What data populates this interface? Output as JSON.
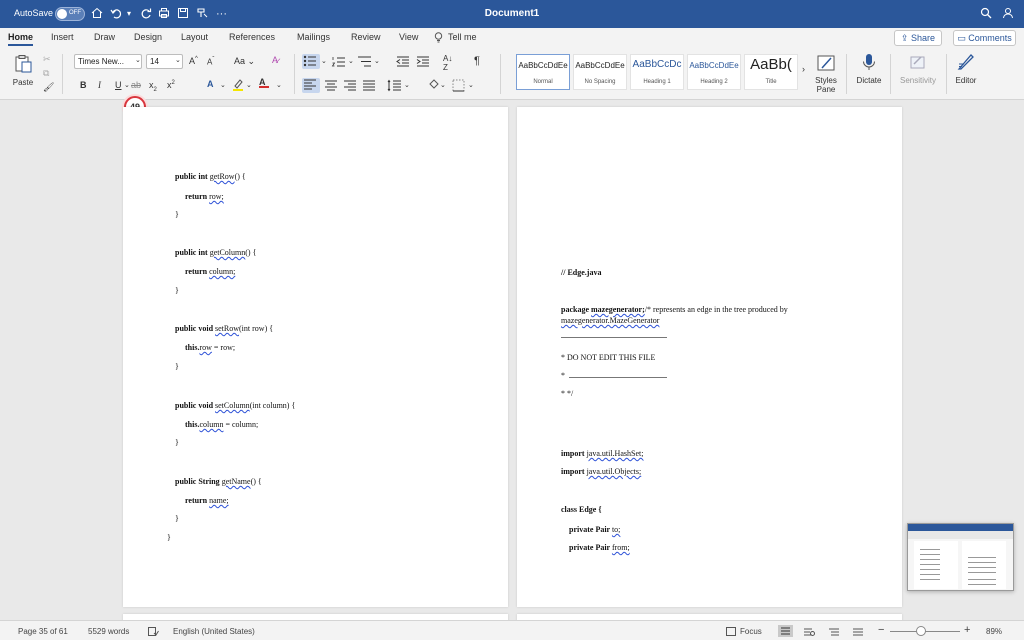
{
  "titlebar": {
    "autosave_label": "AutoSave",
    "autosave_state": "OFF",
    "document_title": "Document1"
  },
  "tabs": [
    "Home",
    "Insert",
    "Draw",
    "Design",
    "Layout",
    "References",
    "Mailings",
    "Review",
    "View"
  ],
  "tell_me": "Tell me",
  "share_label": "Share",
  "comments_label": "Comments",
  "ribbon": {
    "paste_label": "Paste",
    "font_name": "Times New...",
    "font_size": "14",
    "styles": [
      {
        "sample": "AaBbCcDdEe",
        "name": "Normal"
      },
      {
        "sample": "AaBbCcDdEe",
        "name": "No Spacing"
      },
      {
        "sample": "AaBbCcDc",
        "name": "Heading 1"
      },
      {
        "sample": "AaBbCcDdEe",
        "name": "Heading 2"
      },
      {
        "sample": "AaBb(",
        "name": "Title"
      }
    ],
    "styles_pane_label": "Styles Pane",
    "dictate_label": "Dictate",
    "sensitivity_label": "Sensitivity",
    "editor_label": "Editor"
  },
  "comment_badge_count": "49",
  "left_page": {
    "lines": [
      {
        "kw": "public int ",
        "ul": "getRow",
        "rest": "() {"
      },
      {
        "kw": "return ",
        "ul": "row;",
        "rest": ""
      },
      {
        "kw": "",
        "ul": "",
        "rest": "}"
      },
      {
        "kw": "public int ",
        "ul": "getColumn",
        "rest": "() {"
      },
      {
        "kw": "return ",
        "ul": "column;",
        "rest": ""
      },
      {
        "kw": "",
        "ul": "",
        "rest": "}"
      },
      {
        "kw": "public void ",
        "ul": "setRow",
        "rest": "(int row) {"
      },
      {
        "kw": "this.",
        "ul": "row",
        "rest": " = row;"
      },
      {
        "kw": "",
        "ul": "",
        "rest": "}"
      },
      {
        "kw": "public void ",
        "ul": "setColumn",
        "rest": "(int column) {"
      },
      {
        "kw": "this.",
        "ul": "column",
        "rest": " = column;"
      },
      {
        "kw": "",
        "ul": "",
        "rest": "}"
      },
      {
        "kw": "public String ",
        "ul": "getName",
        "rest": "() {"
      },
      {
        "kw": "return ",
        "ul": "name;",
        "rest": ""
      },
      {
        "kw": "",
        "ul": "",
        "rest": "}"
      },
      {
        "kw": "",
        "ul": "",
        "rest": "}"
      }
    ]
  },
  "right_page": {
    "file_comment": "// Edge.java",
    "package_kw": "package ",
    "package_name": "mazegenerator;",
    "package_comment": "/* represents an edge in the tree produced by",
    "package_comment_2": "mazegenerator.MazeGenerator",
    "do_not_edit": "* DO NOT EDIT THIS FILE",
    "star": "*",
    "end_comment": "* */",
    "import_1_kw": "import ",
    "import_1": "java.util.HashSet;",
    "import_2_kw": "import ",
    "import_2": "java.util.Objects;",
    "class_decl": "class Edge {",
    "field_1_kw": "private Pair ",
    "field_1": "to;",
    "field_2_kw": "private Pair ",
    "field_2": "from;"
  },
  "statusbar": {
    "page": "Page 35 of 61",
    "words": "5529 words",
    "language": "English (United States)",
    "focus": "Focus",
    "zoom": "89%"
  }
}
